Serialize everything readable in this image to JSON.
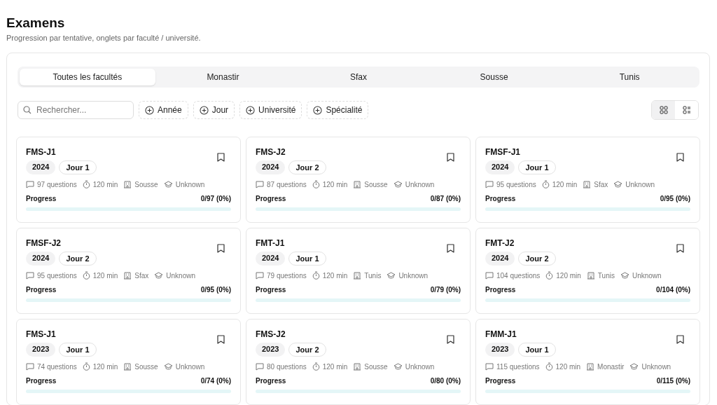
{
  "header": {
    "title": "Examens",
    "subtitle": "Progression par tentative, onglets par faculté / université."
  },
  "tabs": [
    {
      "label": "Toutes les facultés",
      "selected": true
    },
    {
      "label": "Monastir",
      "selected": false
    },
    {
      "label": "Sfax",
      "selected": false
    },
    {
      "label": "Sousse",
      "selected": false
    },
    {
      "label": "Tunis",
      "selected": false
    }
  ],
  "search": {
    "placeholder": "Rechercher..."
  },
  "filters": [
    "Année",
    "Jour",
    "Université",
    "Spécialité"
  ],
  "view_toggle": [
    {
      "kind": "grid",
      "selected": true
    },
    {
      "kind": "list",
      "selected": false
    }
  ],
  "exams": [
    {
      "title": "FMS-J1",
      "year": "2024",
      "day": "Jour 1",
      "questions": "97 questions",
      "duration": "120 min",
      "city": "Sousse",
      "speciality": "Unknown",
      "progress_label": "Progress",
      "reading": "0/97 (0%)",
      "level": 0
    },
    {
      "title": "FMS-J2",
      "year": "2024",
      "day": "Jour 2",
      "questions": "87 questions",
      "duration": "120 min",
      "city": "Sousse",
      "speciality": "Unknown",
      "progress_label": "Progress",
      "reading": "0/87 (0%)",
      "level": 0
    },
    {
      "title": "FMSF-J1",
      "year": "2024",
      "day": "Jour 1",
      "questions": "95 questions",
      "duration": "120 min",
      "city": "Sfax",
      "speciality": "Unknown",
      "progress_label": "Progress",
      "reading": "0/95 (0%)",
      "level": 0
    },
    {
      "title": "FMSF-J2",
      "year": "2024",
      "day": "Jour 2",
      "questions": "95 questions",
      "duration": "120 min",
      "city": "Sfax",
      "speciality": "Unknown",
      "progress_label": "Progress",
      "reading": "0/95 (0%)",
      "level": 0
    },
    {
      "title": "FMT-J1",
      "year": "2024",
      "day": "Jour 1",
      "questions": "79 questions",
      "duration": "120 min",
      "city": "Tunis",
      "speciality": "Unknown",
      "progress_label": "Progress",
      "reading": "0/79 (0%)",
      "level": 0
    },
    {
      "title": "FMT-J2",
      "year": "2024",
      "day": "Jour 2",
      "questions": "104 questions",
      "duration": "120 min",
      "city": "Tunis",
      "speciality": "Unknown",
      "progress_label": "Progress",
      "reading": "0/104 (0%)",
      "level": 0
    },
    {
      "title": "FMS-J1",
      "year": "2023",
      "day": "Jour 1",
      "questions": "74 questions",
      "duration": "120 min",
      "city": "Sousse",
      "speciality": "Unknown",
      "progress_label": "Progress",
      "reading": "0/74 (0%)",
      "level": 0
    },
    {
      "title": "FMS-J2",
      "year": "2023",
      "day": "Jour 2",
      "questions": "80 questions",
      "duration": "120 min",
      "city": "Sousse",
      "speciality": "Unknown",
      "progress_label": "Progress",
      "reading": "0/80 (0%)",
      "level": 0
    },
    {
      "title": "FMM-J1",
      "year": "2023",
      "day": "Jour 1",
      "questions": "115 questions",
      "duration": "120 min",
      "city": "Monastir",
      "speciality": "Unknown",
      "progress_label": "Progress",
      "reading": "0/115 (0%)",
      "level": 0
    }
  ]
}
